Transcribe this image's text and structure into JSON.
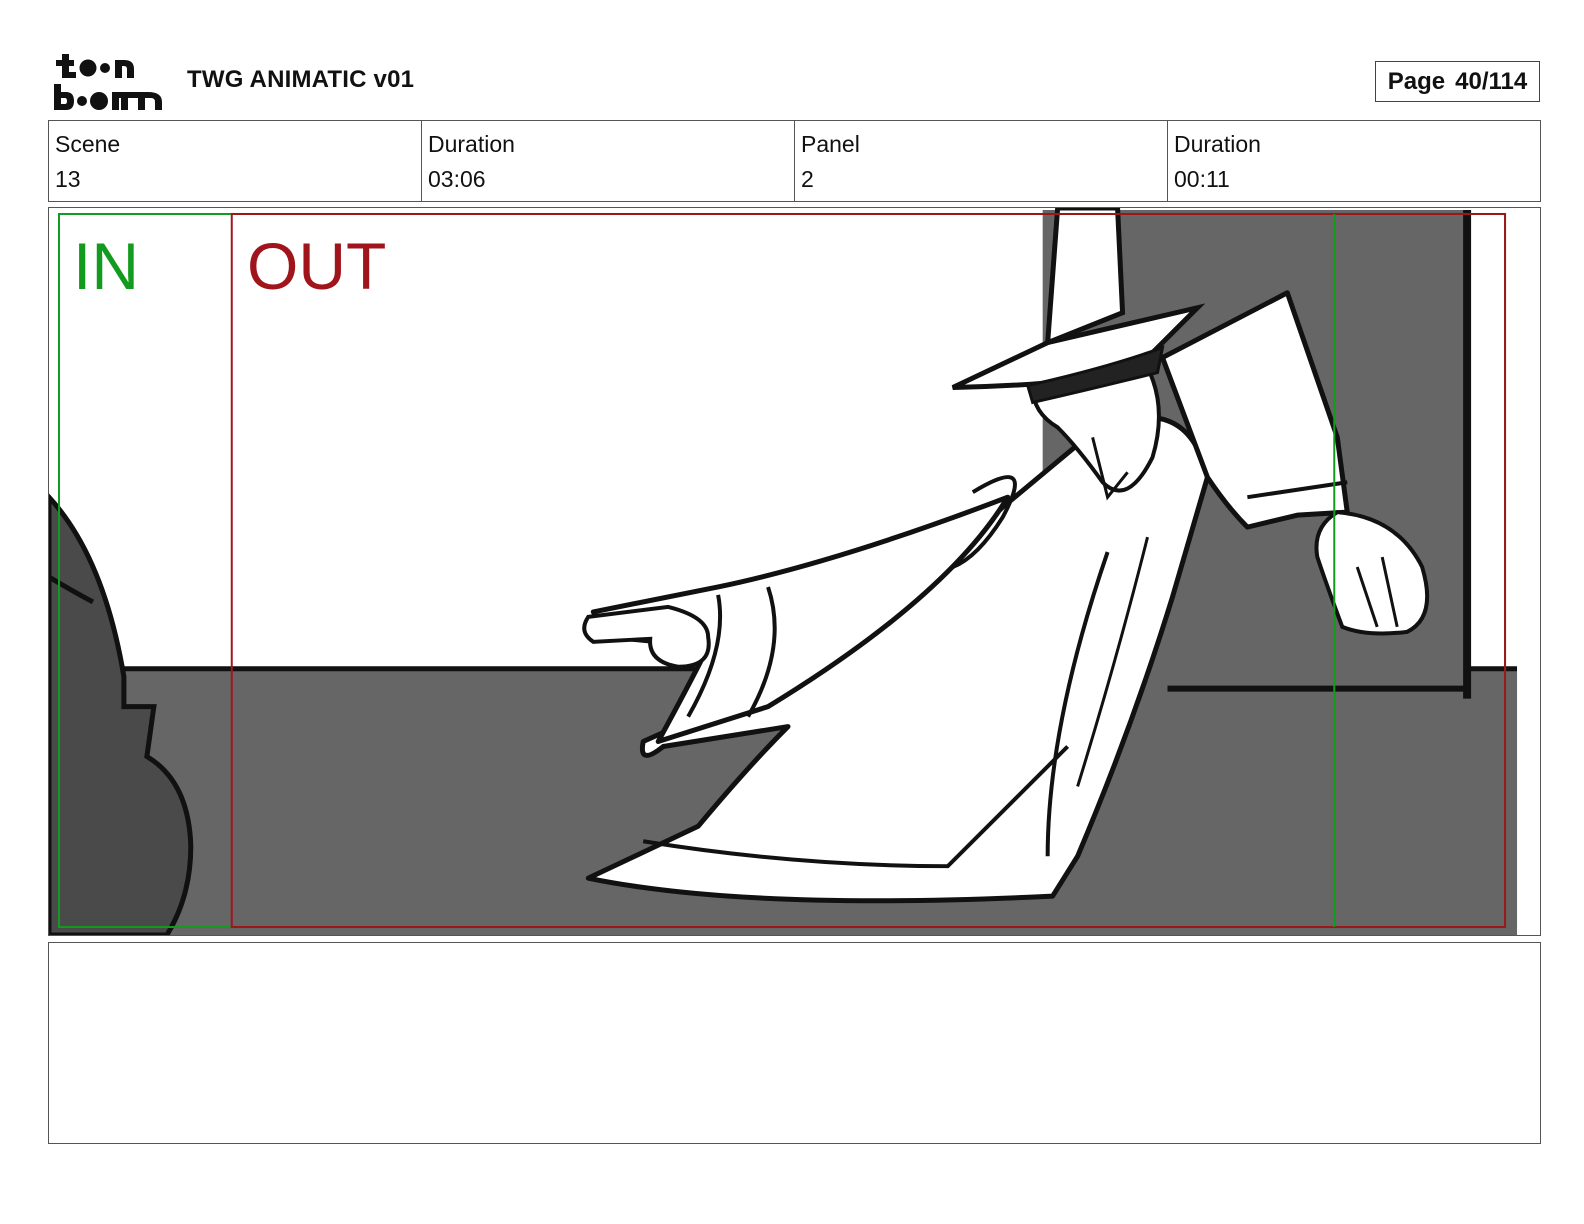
{
  "header": {
    "logo_text": "toonboom",
    "title": "TWG ANIMATIC v01",
    "page_label": "Page",
    "page_value": "40/114"
  },
  "info": {
    "scene_label": "Scene",
    "scene_value": "13",
    "scene_duration_label": "Duration",
    "scene_duration_value": "03:06",
    "panel_label": "Panel",
    "panel_value": "2",
    "panel_duration_label": "Duration",
    "panel_duration_value": "00:11"
  },
  "panel": {
    "in_label": "IN",
    "out_label": "OUT",
    "in_color": "#129b1e",
    "out_color": "#a0141b"
  },
  "notes": {
    "text": ""
  }
}
